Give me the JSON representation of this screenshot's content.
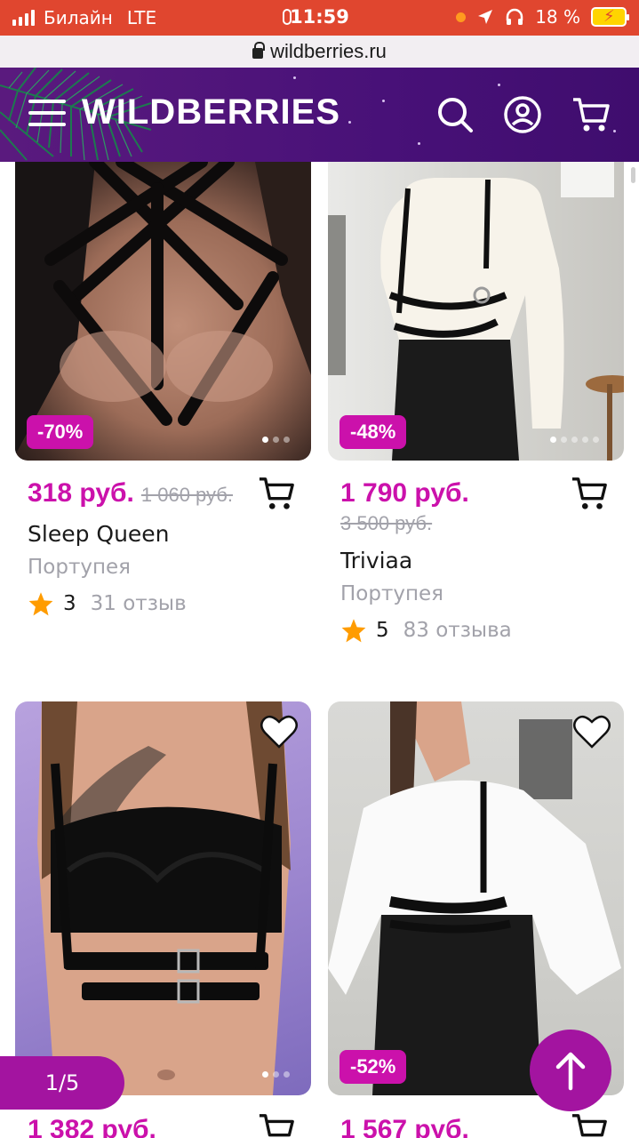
{
  "status_bar": {
    "carrier": "Билайн",
    "network": "LTE",
    "time": "11:59",
    "battery": "18 %"
  },
  "browser": {
    "url": "wildberries.ru"
  },
  "header": {
    "logo": "WILDBERRIES",
    "menu_icon": "hamburger-menu-icon",
    "search_icon": "search-icon",
    "profile_icon": "user-icon",
    "cart_icon": "cart-icon"
  },
  "colors": {
    "brand_purple": "#481178",
    "accent_pink": "#cb11ab",
    "status_bar": "#e0462f",
    "floating_button": "#a314a0"
  },
  "products": [
    {
      "price": "318 руб.",
      "old_price": "1 060 руб.",
      "discount": "-70%",
      "brand": "Sleep Queen",
      "category": "Портупея",
      "rating": "3",
      "reviews": "31 отзыв",
      "images": 3,
      "active_image": 1
    },
    {
      "price": "1 790 руб.",
      "old_price": "3 500 руб.",
      "discount": "-48%",
      "brand": "Triviaa",
      "category": "Портупея",
      "rating": "5",
      "reviews": "83 отзыва",
      "images": 5,
      "active_image": 1
    },
    {
      "price": "1 382 руб.",
      "discount": "",
      "favorite_icon": "heart-icon",
      "images": 3,
      "active_image": 1
    },
    {
      "price": "1 567 руб.",
      "discount": "-52%",
      "favorite_icon": "heart-icon"
    }
  ],
  "pager": {
    "label": "1/5"
  },
  "scroll_top_icon": "arrow-up-icon"
}
